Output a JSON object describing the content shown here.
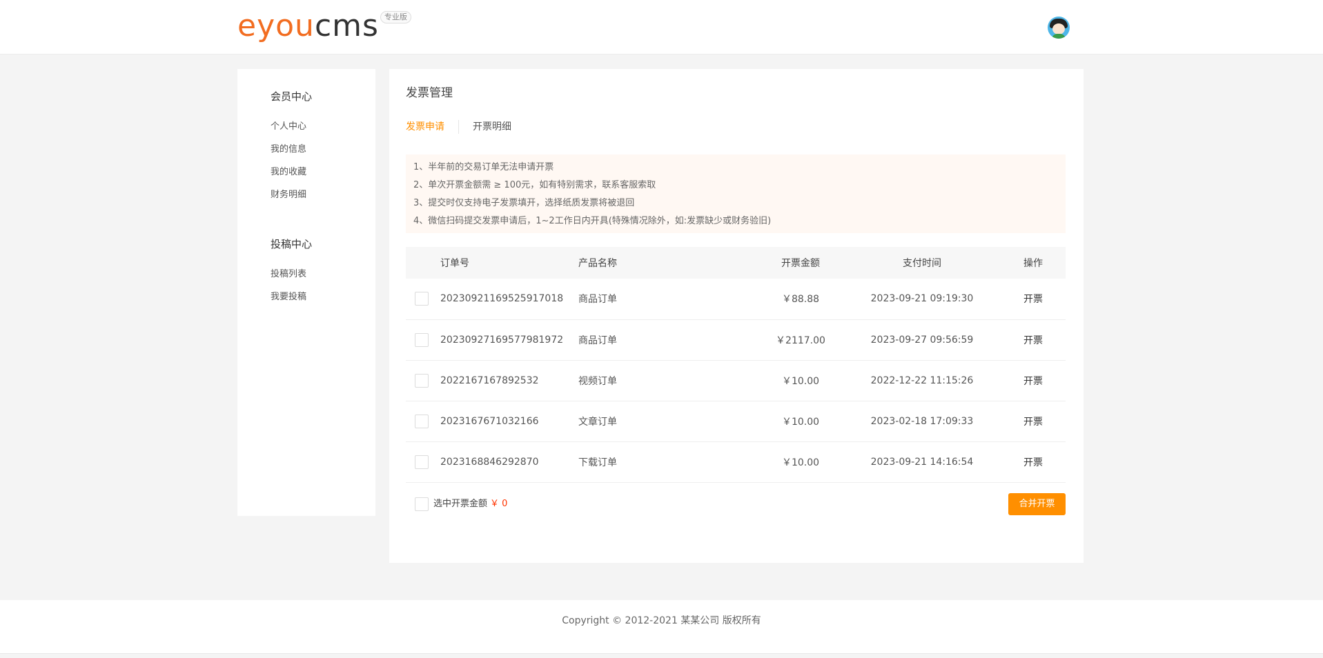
{
  "header": {
    "logo": {
      "part_e": "e",
      "part_you": "you",
      "part_cms": "cms",
      "badge": "专业版"
    },
    "avatar_icon": "user-avatar"
  },
  "sidebar": {
    "groups": [
      {
        "title": "会员中心",
        "items": [
          "个人中心",
          "我的信息",
          "我的收藏",
          "财务明细"
        ]
      },
      {
        "title": "投稿中心",
        "items": [
          "投稿列表",
          "我要投稿"
        ]
      }
    ]
  },
  "main": {
    "title": "发票管理",
    "tabs": [
      {
        "label": "发票申请",
        "active": true
      },
      {
        "label": "开票明细",
        "active": false
      }
    ],
    "notices": [
      "1、半年前的交易订单无法申请开票",
      "2、单次开票金额需 ≥ 100元，如有特别需求，联系客服索取",
      "3、提交时仅支持电子发票填开，选择纸质发票将被退回",
      "4、微信扫码提交发票申请后，1~2工作日内开具(特殊情况除外，如:发票缺少或财务验旧)"
    ],
    "table": {
      "headers": [
        "订单号",
        "产品名称",
        "开票金额",
        "支付时间",
        "操作"
      ],
      "rows": [
        {
          "order": "2023092116952591701​8",
          "product": "商品订单",
          "amount": "￥88.88",
          "time": "2023-09-21 09:19:30",
          "op": "开票"
        },
        {
          "order": "20230927169577981972",
          "product": "商品订单",
          "amount": "￥2117.00",
          "time": "2023-09-27 09:56:59",
          "op": "开票"
        },
        {
          "order": "2022167167892532",
          "product": "视频订单",
          "amount": "￥10.00",
          "time": "2022-12-22 11:15:26",
          "op": "开票"
        },
        {
          "order": "2023167671032166",
          "product": "文章订单",
          "amount": "￥10.00",
          "time": "2023-02-18 17:09:33",
          "op": "开票"
        },
        {
          "order": "2023168846292870",
          "product": "下载订单",
          "amount": "￥10.00",
          "time": "2023-09-21 14:16:54",
          "op": "开票"
        }
      ]
    },
    "selection": {
      "label": "选中开票金额",
      "amount": "￥ 0"
    },
    "merge_button": "合并开票"
  },
  "footer": {
    "copyright": "Copyright © 2012-2021 某某公司 版权所有"
  },
  "colors": {
    "accent": "#ff8f00",
    "logo_orange": "#f26d21",
    "amount_red": "#ff3300",
    "notice_bg": "#fff8f3"
  }
}
